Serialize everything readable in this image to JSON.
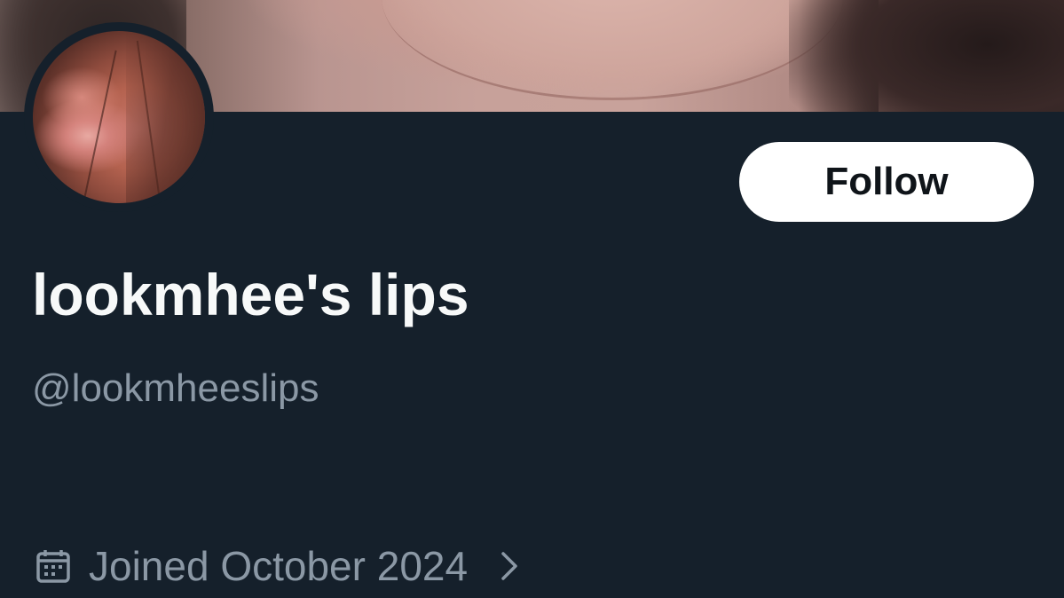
{
  "profile": {
    "display_name": "lookmhee's lips",
    "handle": "@lookmheeslips",
    "joined": "Joined October 2024",
    "follow_label": "Follow"
  },
  "icons": {
    "calendar": "calendar-icon",
    "chevron": "chevron-right-icon"
  },
  "colors": {
    "background": "#15202b",
    "primary_text": "#f7f9f9",
    "secondary_text": "#8b98a5",
    "button_bg": "#ffffff",
    "button_text": "#0f1419"
  }
}
